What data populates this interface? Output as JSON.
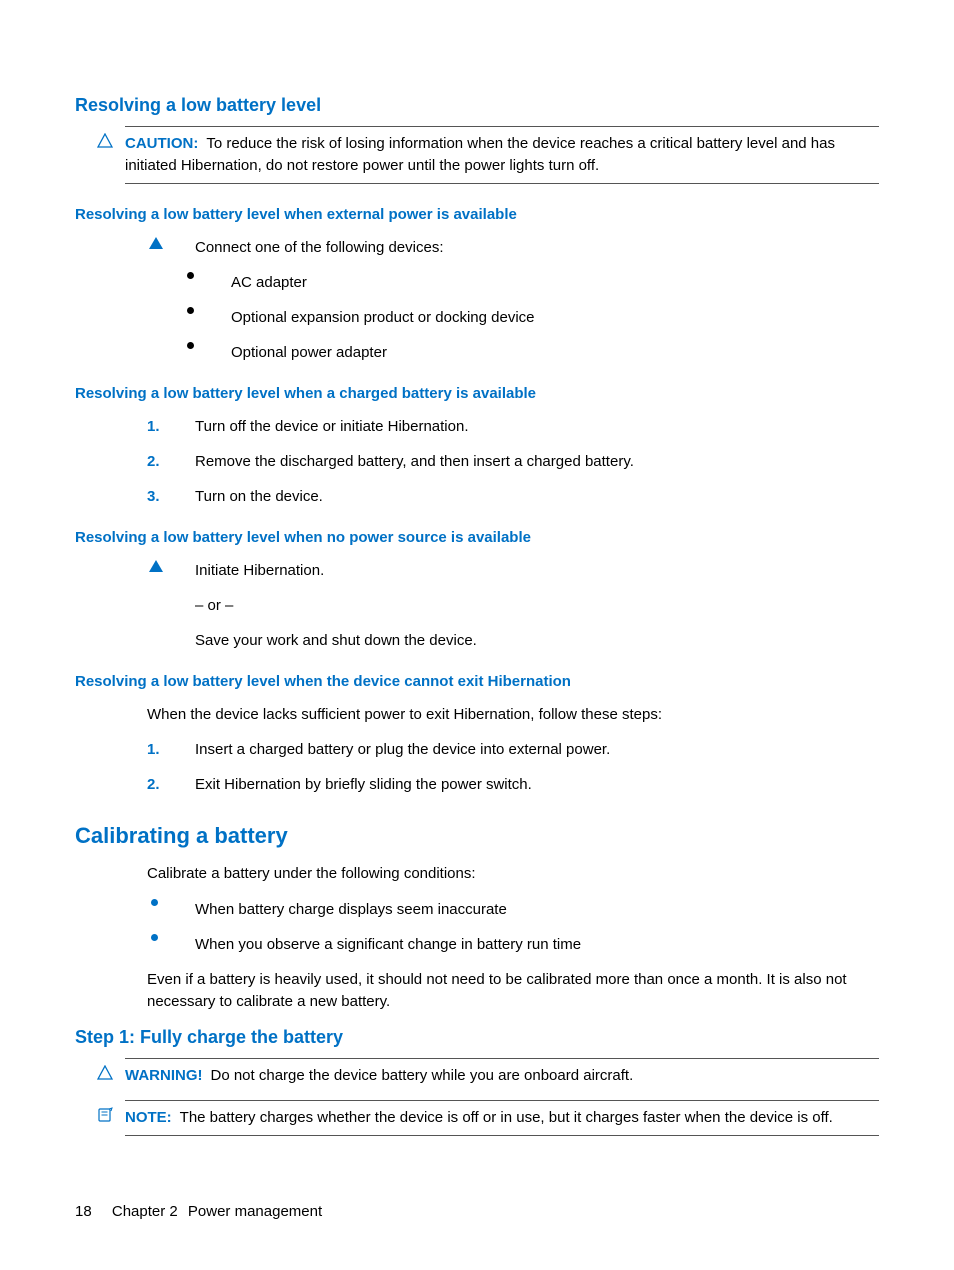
{
  "sections": {
    "resolving": {
      "title": "Resolving a low battery level",
      "caution": {
        "label": "CAUTION:",
        "text": "To reduce the risk of losing information when the device reaches a critical battery level and has initiated Hibernation, do not restore power until the power lights turn off."
      },
      "external": {
        "title": "Resolving a low battery level when external power is available",
        "lead": "Connect one of the following devices:",
        "items": [
          "AC adapter",
          "Optional expansion product or docking device",
          "Optional power adapter"
        ]
      },
      "charged": {
        "title": "Resolving a low battery level when a charged battery is available",
        "steps": [
          "Turn off the device or initiate Hibernation.",
          "Remove the discharged battery, and then insert a charged battery.",
          "Turn on the device."
        ]
      },
      "nopower": {
        "title": "Resolving a low battery level when no power source is available",
        "line1": "Initiate Hibernation.",
        "or": "– or –",
        "line2": "Save your work and shut down the device."
      },
      "cannot_exit": {
        "title": "Resolving a low battery level when the device cannot exit Hibernation",
        "lead": "When the device lacks sufficient power to exit Hibernation, follow these steps:",
        "steps": [
          "Insert a charged battery or plug the device into external power.",
          "Exit Hibernation by briefly sliding the power switch."
        ]
      }
    },
    "calibrating": {
      "title": "Calibrating a battery",
      "lead": "Calibrate a battery under the following conditions:",
      "items": [
        "When battery charge displays seem inaccurate",
        "When you observe a significant change in battery run time"
      ],
      "trail": "Even if a battery is heavily used, it should not need to be calibrated more than once a month. It is also not necessary to calibrate a new battery.",
      "step1": {
        "title": "Step 1: Fully charge the battery",
        "warning": {
          "label": "WARNING!",
          "text": "Do not charge the device battery while you are onboard aircraft."
        },
        "note": {
          "label": "NOTE:",
          "text": "The battery charges whether the device is off or in use, but it charges faster when the device is off."
        }
      }
    }
  },
  "footer": {
    "page": "18",
    "chapter": "Chapter 2",
    "title": "Power management"
  }
}
